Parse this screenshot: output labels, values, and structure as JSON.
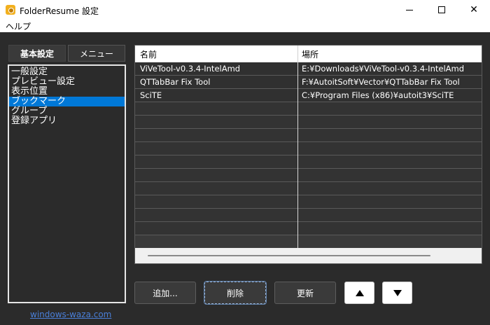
{
  "window": {
    "title": "FolderResume 設定",
    "minimize_icon": "minimize-icon",
    "maximize_icon": "maximize-icon",
    "close_icon": "close-icon",
    "close_glyph": "✕"
  },
  "menubar": {
    "help": "ヘルプ"
  },
  "tabs": {
    "basic": "基本設定",
    "menu": "メニュー"
  },
  "settings_list": {
    "items": [
      "一般設定",
      "プレビュー設定",
      "表示位置",
      "ブックマーク",
      "グループ",
      "登録アプリ"
    ],
    "selected": "ブックマーク"
  },
  "grid": {
    "columns": {
      "name": "名前",
      "location": "場所"
    },
    "rows": [
      {
        "name": "ViVeTool-v0.3.4-IntelAmd",
        "location": "E:¥Downloads¥ViVeTool-v0.3.4-IntelAmd"
      },
      {
        "name": "QTTabBar Fix Tool",
        "location": "F:¥AutoitSoft¥Vector¥QTTabBar Fix Tool"
      },
      {
        "name": "SciTE",
        "location": "C:¥Program Files (x86)¥autoit3¥SciTE"
      }
    ],
    "empty_rows": 10
  },
  "buttons": {
    "add": "追加...",
    "delete": "削除",
    "update": "更新",
    "up_icon": "arrow-up-icon",
    "down_icon": "arrow-down-icon"
  },
  "footer": {
    "link": "windows-waza.com"
  },
  "colors": {
    "background": "#2b2b2b",
    "selection": "#0078d7",
    "link": "#4a7fd8"
  }
}
